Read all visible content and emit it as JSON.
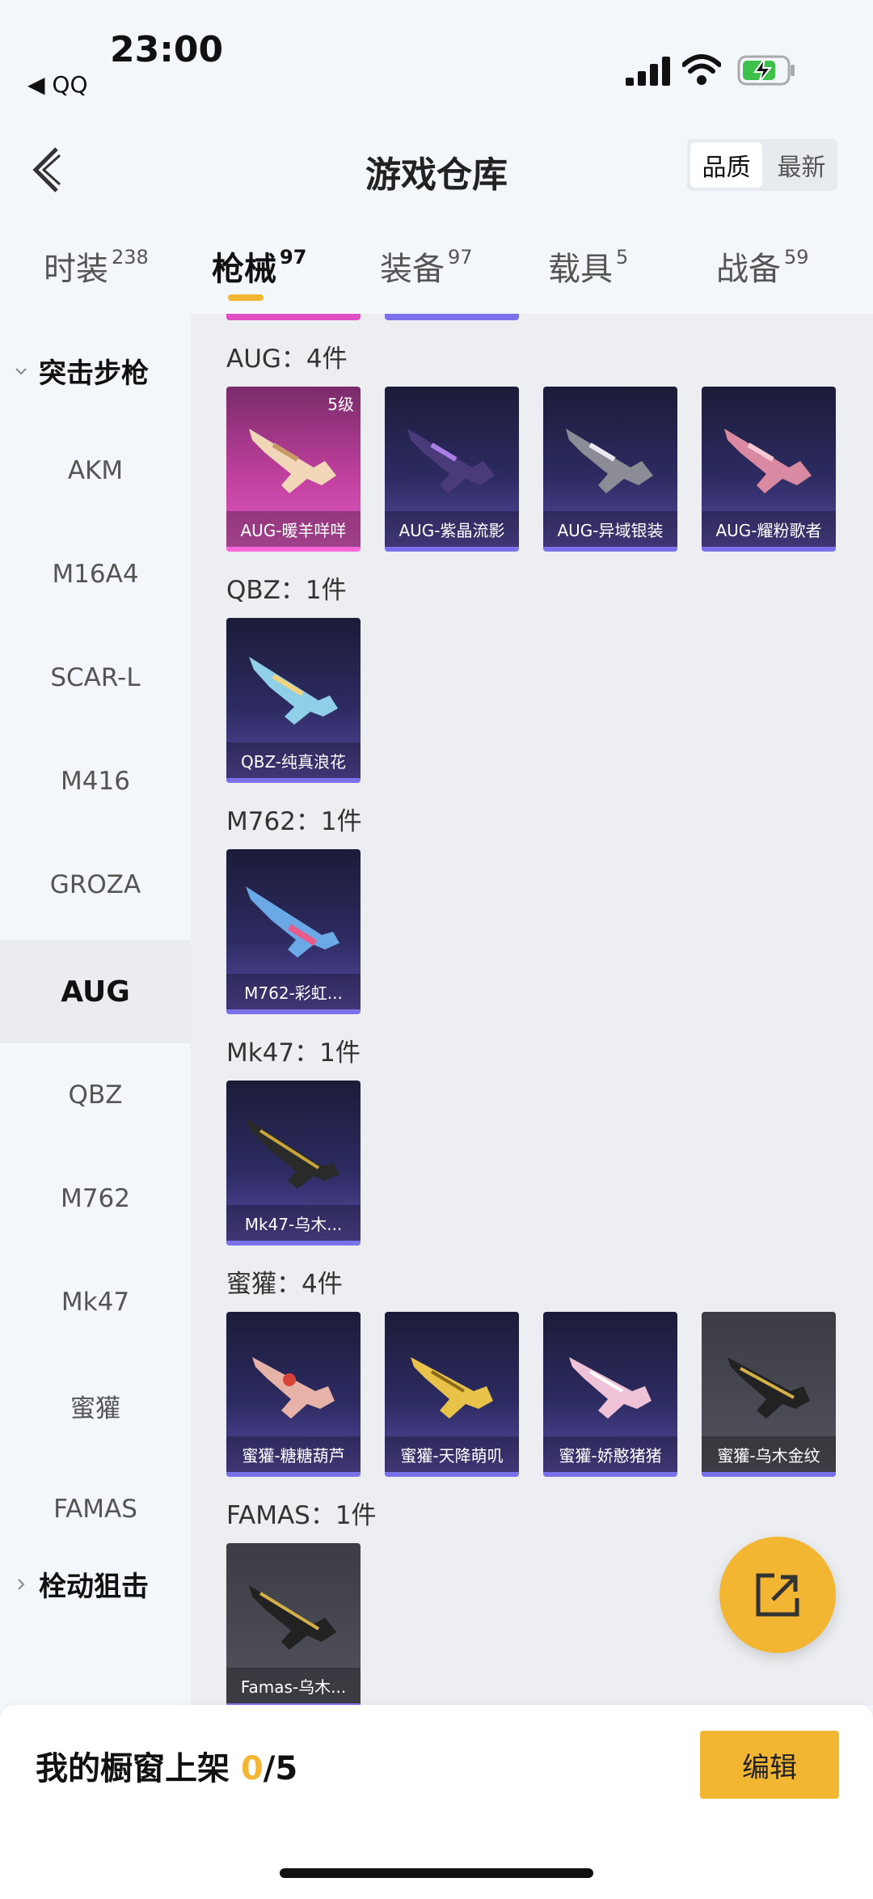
{
  "status": {
    "time": "23:00",
    "back_app": "◀ QQ"
  },
  "header": {
    "title": "游戏仓库",
    "sort_quality": "品质",
    "sort_latest": "最新"
  },
  "tabs": [
    {
      "label": "时装",
      "count": "238"
    },
    {
      "label": "枪械",
      "count": "97"
    },
    {
      "label": "装备",
      "count": "97"
    },
    {
      "label": "载具",
      "count": "5"
    },
    {
      "label": "战备",
      "count": "59"
    }
  ],
  "sidebar": {
    "category_open": "突击步枪",
    "items": [
      "AKM",
      "M16A4",
      "SCAR-L",
      "M416",
      "GROZA",
      "AUG",
      "QBZ",
      "M762",
      "Mk47",
      "蜜獾",
      "FAMAS"
    ],
    "category_closed": "栓动狙击"
  },
  "sections": [
    {
      "title": "AUG：4件",
      "items": [
        {
          "name": "AUG-暖羊咩咩",
          "level": "5级"
        },
        {
          "name": "AUG-紫晶流影"
        },
        {
          "name": "AUG-异域银装"
        },
        {
          "name": "AUG-耀粉歌者"
        }
      ]
    },
    {
      "title": "QBZ：1件",
      "items": [
        {
          "name": "QBZ-纯真浪花"
        }
      ]
    },
    {
      "title": "M762：1件",
      "items": [
        {
          "name": "M762-彩虹..."
        }
      ]
    },
    {
      "title": "Mk47：1件",
      "items": [
        {
          "name": "Mk47-乌木..."
        }
      ]
    },
    {
      "title": "蜜獾：4件",
      "items": [
        {
          "name": "蜜獾-糖糖葫芦"
        },
        {
          "name": "蜜獾-天降萌叽"
        },
        {
          "name": "蜜獾-娇憨猪猪"
        },
        {
          "name": "蜜獾-乌木金纹"
        }
      ]
    },
    {
      "title": "FAMAS：1件",
      "items": [
        {
          "name": "Famas-乌木..."
        }
      ]
    }
  ],
  "bottom": {
    "text": "我的橱窗上架",
    "count": "0",
    "total": "/5",
    "edit_label": "编辑"
  },
  "colors": {
    "accent": "#f2b632",
    "purple_bar": "#7b72e9",
    "pink_bar": "#ff66d8"
  }
}
